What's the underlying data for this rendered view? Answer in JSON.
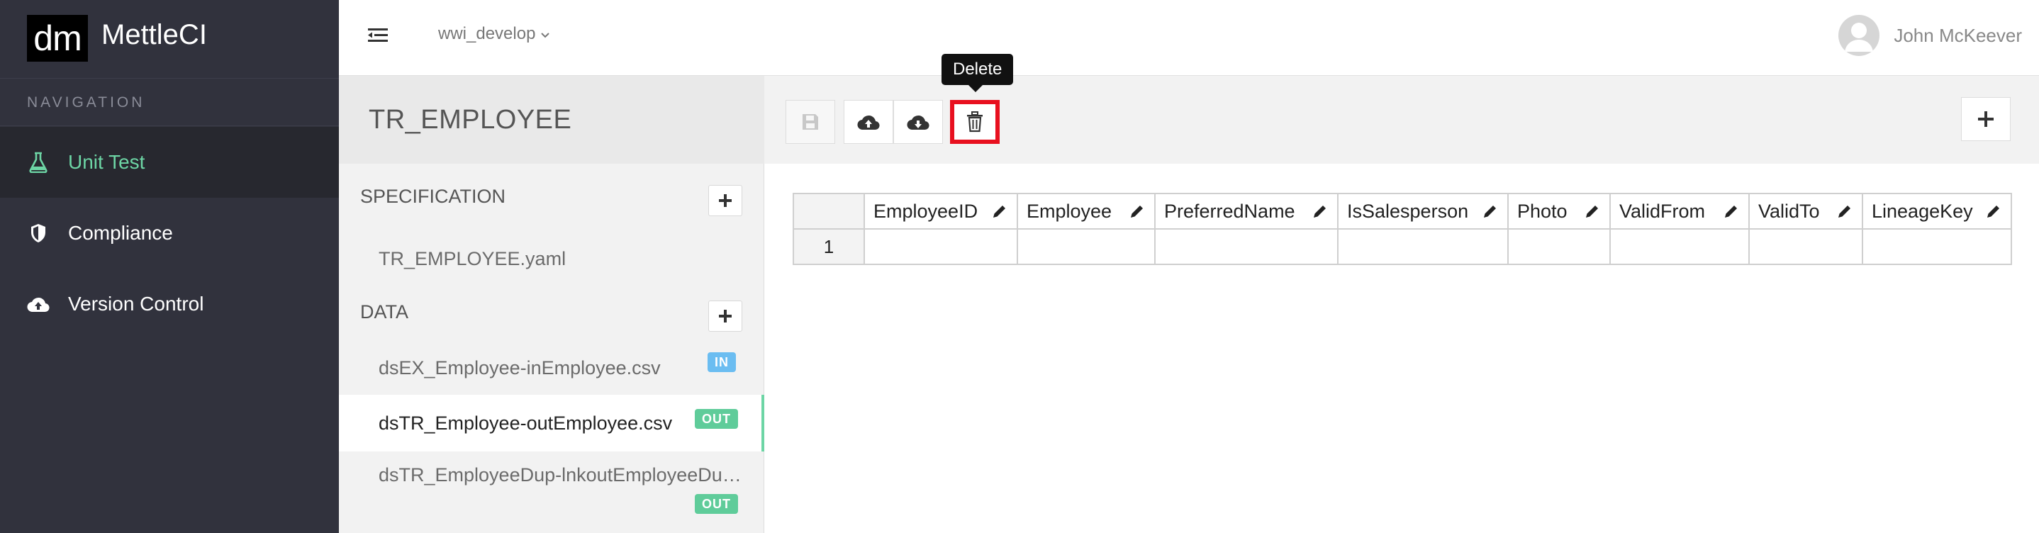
{
  "app": {
    "logo_text": "dm",
    "name": "MettleCI"
  },
  "navigation": {
    "heading": "NAVIGATION",
    "items": [
      {
        "label": "Unit Test",
        "icon": "flask-icon",
        "active": true
      },
      {
        "label": "Compliance",
        "icon": "shield-icon",
        "active": false
      },
      {
        "label": "Version Control",
        "icon": "cloud-upload-icon",
        "active": false
      }
    ]
  },
  "header": {
    "branch": "wwi_develop",
    "user_name": "John McKeever"
  },
  "panel": {
    "title": "TR_EMPLOYEE",
    "specification": {
      "label": "SPECIFICATION",
      "files": [
        "TR_EMPLOYEE.yaml"
      ]
    },
    "data": {
      "label": "DATA",
      "files": [
        {
          "name": "dsEX_Employee-inEmployee.csv",
          "badge": "IN"
        },
        {
          "name": "dsTR_Employee-outEmployee.csv",
          "badge": "OUT"
        },
        {
          "name": "dsTR_EmployeeDup-lnkoutEmployeeDu…",
          "badge": "OUT"
        }
      ]
    }
  },
  "toolbar": {
    "tooltip": "Delete",
    "buttons": [
      "save-icon",
      "cloud-upload-icon",
      "cloud-download-icon",
      "trash-icon"
    ],
    "highlight_color": "#e8101f"
  },
  "grid": {
    "columns": [
      "EmployeeID",
      "Employee",
      "PreferredName",
      "IsSalesperson",
      "Photo",
      "ValidFrom",
      "ValidTo",
      "LineageKey"
    ],
    "rows": [
      {
        "num": "1",
        "cells": [
          "",
          "",
          "",
          "",
          "",
          "",
          "",
          ""
        ]
      }
    ]
  },
  "colors": {
    "sidebar": "#31323d",
    "accent": "#6dd5a5",
    "badge_in": "#6bbdf1",
    "badge_out": "#5fcc9a"
  }
}
